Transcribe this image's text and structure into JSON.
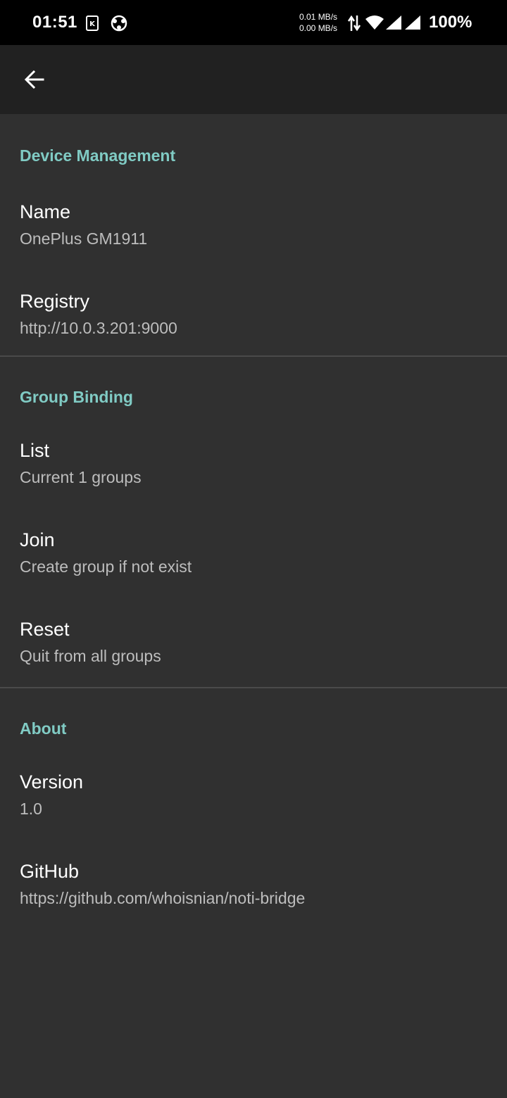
{
  "status_bar": {
    "time": "01:51",
    "net_up": "0.01 MB/s",
    "net_down": "0.00 MB/s",
    "battery": "100%",
    "icons": [
      "sim-card-icon",
      "vpn-icon",
      "data-arrows-icon",
      "wifi-icon",
      "signal-icon",
      "signal-icon"
    ]
  },
  "app_bar": {
    "back_icon": "arrow-back-icon"
  },
  "sections": {
    "device": {
      "header": "Device Management",
      "name_title": "Name",
      "name_summary": "OnePlus GM1911",
      "registry_title": "Registry",
      "registry_summary": "http://10.0.3.201:9000"
    },
    "group": {
      "header": "Group Binding",
      "list_title": "List",
      "list_summary": "Current 1 groups",
      "join_title": "Join",
      "join_summary": "Create group if not exist",
      "reset_title": "Reset",
      "reset_summary": "Quit from all groups"
    },
    "about": {
      "header": "About",
      "version_title": "Version",
      "version_summary": "1.0",
      "github_title": "GitHub",
      "github_summary": "https://github.com/whoisnian/noti-bridge"
    }
  },
  "colors": {
    "background": "#303030",
    "app_bar": "#212121",
    "status_bar": "#000000",
    "accent": "#80cbc4",
    "summary_text": "#bdbdbd",
    "divider": "#4a4a4a"
  }
}
